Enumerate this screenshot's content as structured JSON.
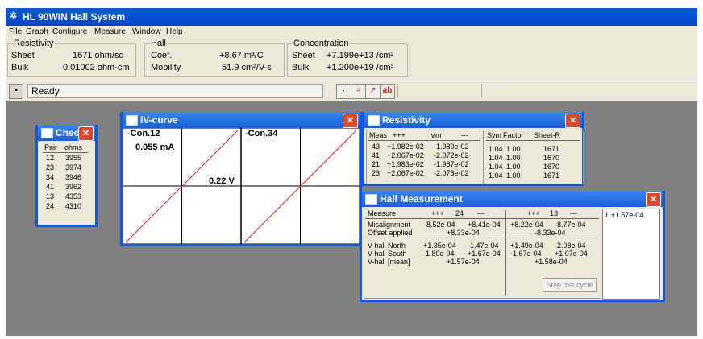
{
  "app": {
    "title": "HL 90WIN Hall System"
  },
  "menu": [
    "File",
    "Graph",
    "Configure",
    "Measure",
    "Window",
    "Help"
  ],
  "resistivity_group": {
    "title": "Resistivity",
    "sheet_label": "Sheet",
    "sheet_value": "1671 ohm/sq",
    "bulk_label": "Bulk",
    "bulk_value": "0.01002 ohm-cm"
  },
  "hall_group": {
    "title": "Hall",
    "coef_label": "Coef.",
    "coef_value": "+8.67 m³/C",
    "mobility_label": "Mobility",
    "mobility_value": "51.9 cm²/V-s"
  },
  "concentration_group": {
    "title": "Concentration",
    "sheet_label": "Sheet",
    "sheet_value": "+7.199e+13 /cm²",
    "bulk_label": "Bulk",
    "bulk_value": "+1.200e+19 /cm³"
  },
  "status": {
    "text": "Ready"
  },
  "check_window": {
    "title": "Check",
    "col_pair": "Pair",
    "col_ohms": "ohms",
    "rows": [
      {
        "pair": "12",
        "ohms": "3955"
      },
      {
        "pair": "23",
        "ohms": "3974"
      },
      {
        "pair": "34",
        "ohms": "3946"
      },
      {
        "pair": "41",
        "ohms": "3962"
      },
      {
        "pair": "13",
        "ohms": "4353"
      },
      {
        "pair": "24",
        "ohms": "4310"
      }
    ]
  },
  "iv_window": {
    "title": "IV-curve",
    "left_label": "Con.12",
    "right_label": "Con.34",
    "current_label": "0.055 mA",
    "voltage_label": "0.22 V"
  },
  "resistivity_window": {
    "title": "Resistivity",
    "headers": [
      "Meas",
      "+++",
      "Vm",
      "---",
      "Sym",
      "Factor",
      "Sheet-R"
    ],
    "rows": [
      {
        "meas": "43",
        "plus": "+1.982e-02",
        "minus": "-1.989e-02",
        "sym": "1.04",
        "factor": "1.00",
        "sheet": "1671"
      },
      {
        "meas": "41",
        "plus": "+2.067e-02",
        "minus": "-2.072e-02",
        "sym": "1.04",
        "factor": "1.00",
        "sheet": "1670"
      },
      {
        "meas": "21",
        "plus": "+1.983e-02",
        "minus": "-1.987e-02",
        "sym": "1.04",
        "factor": "1.00",
        "sheet": "1670"
      },
      {
        "meas": "23",
        "plus": "+2.067e-02",
        "minus": "-2.073e-02",
        "sym": "1.04",
        "factor": "1.00",
        "sheet": "1671"
      }
    ]
  },
  "hall_window": {
    "title": "Hall Measurement",
    "measure_label": "Measure",
    "left_head": {
      "plus": "+++",
      "num": "24",
      "minus": "---"
    },
    "right_head": {
      "plus": "+++",
      "num": "13",
      "minus": "---"
    },
    "misalignment_label": "Misalignment",
    "misalignment_left": [
      "-8.52e-04",
      "+8.41e-04"
    ],
    "misalignment_right": [
      "+8.22e-04",
      "-8.77e-04"
    ],
    "offset_label": "Offset applied",
    "offset_left": "+8.33e-04",
    "offset_right": "-8.33e-04",
    "vnorth_label": "V-hall North",
    "vnorth_left": [
      "+1.35e-04",
      "-1.47e-04"
    ],
    "vnorth_right": [
      "+1.49e-04",
      "-2.08e-04"
    ],
    "vsouth_label": "V-hall South",
    "vsouth_left": [
      "-1.80e-04",
      "+1.67e-04"
    ],
    "vsouth_right": [
      "-1.67e-04",
      "+1.07e-04"
    ],
    "vmean_label": "V-hall [mean]",
    "vmean_left": "+1.57e-04",
    "vmean_right": "+1.58e-04",
    "stop_button": "Stop this cycle",
    "result_text": "1 +1.57e-04"
  }
}
